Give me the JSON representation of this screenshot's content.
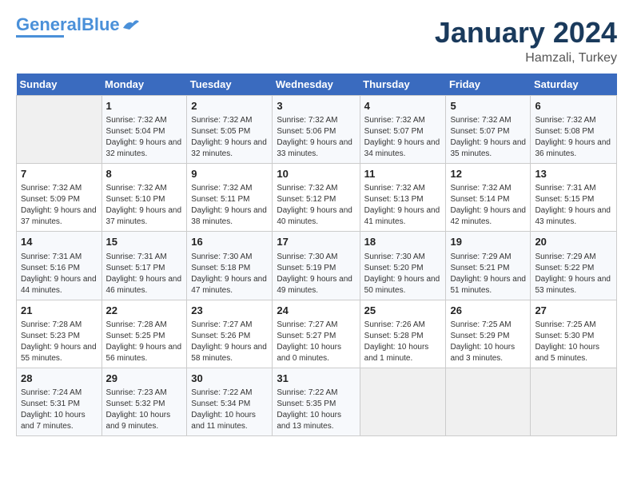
{
  "header": {
    "logo_line1": "General",
    "logo_line2": "Blue",
    "month": "January 2024",
    "location": "Hamzali, Turkey"
  },
  "weekdays": [
    "Sunday",
    "Monday",
    "Tuesday",
    "Wednesday",
    "Thursday",
    "Friday",
    "Saturday"
  ],
  "weeks": [
    [
      {
        "day": "",
        "empty": true
      },
      {
        "day": "1",
        "sunrise": "7:32 AM",
        "sunset": "5:04 PM",
        "daylight": "9 hours and 32 minutes."
      },
      {
        "day": "2",
        "sunrise": "7:32 AM",
        "sunset": "5:05 PM",
        "daylight": "9 hours and 32 minutes."
      },
      {
        "day": "3",
        "sunrise": "7:32 AM",
        "sunset": "5:06 PM",
        "daylight": "9 hours and 33 minutes."
      },
      {
        "day": "4",
        "sunrise": "7:32 AM",
        "sunset": "5:07 PM",
        "daylight": "9 hours and 34 minutes."
      },
      {
        "day": "5",
        "sunrise": "7:32 AM",
        "sunset": "5:07 PM",
        "daylight": "9 hours and 35 minutes."
      },
      {
        "day": "6",
        "sunrise": "7:32 AM",
        "sunset": "5:08 PM",
        "daylight": "9 hours and 36 minutes."
      }
    ],
    [
      {
        "day": "7",
        "sunrise": "7:32 AM",
        "sunset": "5:09 PM",
        "daylight": "9 hours and 37 minutes."
      },
      {
        "day": "8",
        "sunrise": "7:32 AM",
        "sunset": "5:10 PM",
        "daylight": "9 hours and 37 minutes."
      },
      {
        "day": "9",
        "sunrise": "7:32 AM",
        "sunset": "5:11 PM",
        "daylight": "9 hours and 38 minutes."
      },
      {
        "day": "10",
        "sunrise": "7:32 AM",
        "sunset": "5:12 PM",
        "daylight": "9 hours and 40 minutes."
      },
      {
        "day": "11",
        "sunrise": "7:32 AM",
        "sunset": "5:13 PM",
        "daylight": "9 hours and 41 minutes."
      },
      {
        "day": "12",
        "sunrise": "7:32 AM",
        "sunset": "5:14 PM",
        "daylight": "9 hours and 42 minutes."
      },
      {
        "day": "13",
        "sunrise": "7:31 AM",
        "sunset": "5:15 PM",
        "daylight": "9 hours and 43 minutes."
      }
    ],
    [
      {
        "day": "14",
        "sunrise": "7:31 AM",
        "sunset": "5:16 PM",
        "daylight": "9 hours and 44 minutes."
      },
      {
        "day": "15",
        "sunrise": "7:31 AM",
        "sunset": "5:17 PM",
        "daylight": "9 hours and 46 minutes."
      },
      {
        "day": "16",
        "sunrise": "7:30 AM",
        "sunset": "5:18 PM",
        "daylight": "9 hours and 47 minutes."
      },
      {
        "day": "17",
        "sunrise": "7:30 AM",
        "sunset": "5:19 PM",
        "daylight": "9 hours and 49 minutes."
      },
      {
        "day": "18",
        "sunrise": "7:30 AM",
        "sunset": "5:20 PM",
        "daylight": "9 hours and 50 minutes."
      },
      {
        "day": "19",
        "sunrise": "7:29 AM",
        "sunset": "5:21 PM",
        "daylight": "9 hours and 51 minutes."
      },
      {
        "day": "20",
        "sunrise": "7:29 AM",
        "sunset": "5:22 PM",
        "daylight": "9 hours and 53 minutes."
      }
    ],
    [
      {
        "day": "21",
        "sunrise": "7:28 AM",
        "sunset": "5:23 PM",
        "daylight": "9 hours and 55 minutes."
      },
      {
        "day": "22",
        "sunrise": "7:28 AM",
        "sunset": "5:25 PM",
        "daylight": "9 hours and 56 minutes."
      },
      {
        "day": "23",
        "sunrise": "7:27 AM",
        "sunset": "5:26 PM",
        "daylight": "9 hours and 58 minutes."
      },
      {
        "day": "24",
        "sunrise": "7:27 AM",
        "sunset": "5:27 PM",
        "daylight": "10 hours and 0 minutes."
      },
      {
        "day": "25",
        "sunrise": "7:26 AM",
        "sunset": "5:28 PM",
        "daylight": "10 hours and 1 minute."
      },
      {
        "day": "26",
        "sunrise": "7:25 AM",
        "sunset": "5:29 PM",
        "daylight": "10 hours and 3 minutes."
      },
      {
        "day": "27",
        "sunrise": "7:25 AM",
        "sunset": "5:30 PM",
        "daylight": "10 hours and 5 minutes."
      }
    ],
    [
      {
        "day": "28",
        "sunrise": "7:24 AM",
        "sunset": "5:31 PM",
        "daylight": "10 hours and 7 minutes."
      },
      {
        "day": "29",
        "sunrise": "7:23 AM",
        "sunset": "5:32 PM",
        "daylight": "10 hours and 9 minutes."
      },
      {
        "day": "30",
        "sunrise": "7:22 AM",
        "sunset": "5:34 PM",
        "daylight": "10 hours and 11 minutes."
      },
      {
        "day": "31",
        "sunrise": "7:22 AM",
        "sunset": "5:35 PM",
        "daylight": "10 hours and 13 minutes."
      },
      {
        "day": "",
        "empty": true
      },
      {
        "day": "",
        "empty": true
      },
      {
        "day": "",
        "empty": true
      }
    ]
  ]
}
